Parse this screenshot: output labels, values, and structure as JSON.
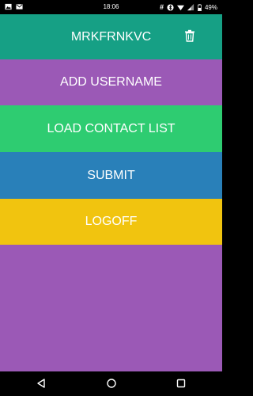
{
  "status_bar": {
    "time": "18:06",
    "battery": "49%",
    "icons": [
      "image-icon",
      "gmail-icon",
      "hash-icon",
      "bluetooth-icon",
      "wifi-icon",
      "signal-icon",
      "battery-icon"
    ]
  },
  "header": {
    "title": "MRKFRNKVC",
    "action_icon": "trash-icon"
  },
  "buttons": {
    "add_username": "ADD USERNAME",
    "load_contact_list": "LOAD CONTACT LIST",
    "submit": "SUBMIT",
    "logoff": "LOGOFF"
  },
  "colors": {
    "header": "#16a085",
    "add_username": "#9b59b6",
    "load_contact_list": "#2ecc71",
    "submit": "#2980b9",
    "logoff": "#f1c40f",
    "background": "#9b59b6"
  },
  "nav_bar": {
    "icons": [
      "back-icon",
      "home-icon",
      "recents-icon"
    ]
  }
}
